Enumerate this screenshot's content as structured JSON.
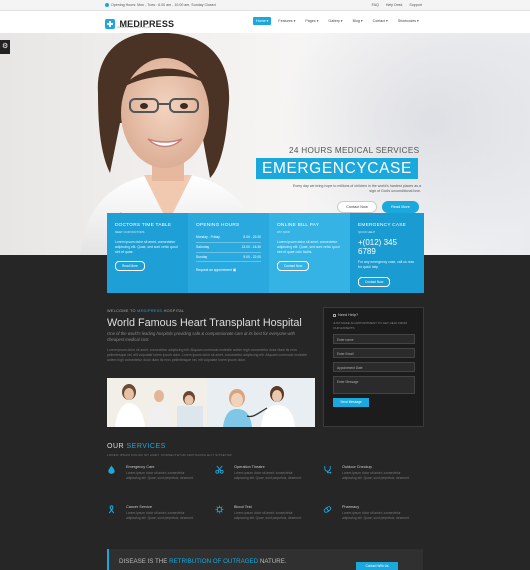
{
  "topbar": {
    "hours": "Opening Hours: Mon - Tues : 6.00 am - 10.00 am, Sunday Closed",
    "links": [
      "FAQ",
      "Help Desk",
      "Support"
    ]
  },
  "header": {
    "logo": "MEDIPRESS",
    "tagline": "medical & health care template",
    "nav": [
      {
        "label": "Home",
        "active": true
      },
      {
        "label": "Features",
        "active": false
      },
      {
        "label": "Pages",
        "active": false
      },
      {
        "label": "Gallery",
        "active": false
      },
      {
        "label": "Blog",
        "active": false
      },
      {
        "label": "Contact",
        "active": false
      },
      {
        "label": "Shortcodes",
        "active": false
      }
    ]
  },
  "hero": {
    "subtitle": "24 HOURS MEDICAL SERVICES",
    "title": "EMERGENCYCASE",
    "text": "Every day we bring hope to millions of children in the world's hardest places as a sign of God's unconditional love.",
    "btn_contact": "Contact Now",
    "btn_more": "Read More"
  },
  "boxes": {
    "timetable": {
      "title": "DOCTORS TIME TABLE",
      "sub": "MEET OUR DOCTORS",
      "text": "Lorem ipsum dolor sit amet, consectetur adipiscing elit. Quae, sed sunt vehic quod sint et quae.",
      "btn": "Read More"
    },
    "hours": {
      "title": "OPENING HOURS",
      "rows": [
        {
          "day": "Monday - Friday",
          "time": "8.00 - 22.00"
        },
        {
          "day": "Saturday",
          "time": "13.00 - 16.30"
        },
        {
          "day": "Sunday",
          "time": "9.00 - 22.00"
        }
      ],
      "link": "Request an appointment"
    },
    "bill": {
      "title": "ONLINE BILL PAY",
      "sub": "PAY NOW",
      "text": "Lorem ipsum dolor sit amet, consectetur adipiscing elit. Quae, sed sunt vehic quod sint et quae odio facilis.",
      "btn": "Contact Now"
    },
    "emergency": {
      "title": "EMERGENCY CASE",
      "sub": "QUICK HELP",
      "phone": "+(012) 345 6789",
      "text": "For any emergency case, call us now for quick help",
      "btn": "Contact Now"
    }
  },
  "welcome": {
    "kicker_pre": "WELCOME TO",
    "kicker_brand": "MEDIPRESS",
    "kicker_post": "HOSPITAL",
    "title": "World Famous Heart Transplant Hospital",
    "lead": "One of the world's leading hospitals providing safe & compassionate care at its best for everyone with cheapest medical cost.",
    "body": "Lorem ipsum dolor sit amet, consectetur adipiscing elit. Aliquam commodo molestie autem high consectetur dolor diam its eros pellentesque vel, elit vulputate lorem ipsum dolor. Lorem ipsum dolor sit amet, consectetur adipiscing elit. Aliquam commodo molestie autem high consectetur dolor diam its eros pellentesque vel, elit vulputate lorem ipsum dolor."
  },
  "form": {
    "heading": "Need Help?",
    "sub": "JUST MAKE AN APPOINTMENT TO GET HELP FROM OUR EXPERTS",
    "name": "Enter name",
    "email": "Enter Email",
    "date": "Appointment Date",
    "message": "Enter Message",
    "send": "Send Message"
  },
  "services": {
    "title_pre": "OUR",
    "title_em": "SERVICES",
    "sub": "LOREM IPSUM DOLOR SIT AMET, CONSECTETUR ADIPISCING ELIT SITSETUR",
    "items": [
      {
        "title": "Emergency Care",
        "text": "Lorem ipsum dolor sit amet, consectetur adipiscing elit. Quae, sunt perpetuis, deserunt."
      },
      {
        "title": "Operation Theatre",
        "text": "Lorem ipsum dolor sit amet, consectetur adipiscing elit. Quae, sunt perpetuis, deserunt."
      },
      {
        "title": "Outdoor Checkup",
        "text": "Lorem ipsum dolor sit amet, consectetur adipiscing elit. Quae, sunt perpetuis, deserunt."
      },
      {
        "title": "Cancer Service",
        "text": "Lorem ipsum dolor sit amet, consectetur adipiscing elit. Quae, sunt perpetuis, deserunt."
      },
      {
        "title": "Blood Test",
        "text": "Lorem ipsum dolor sit amet, consectetur adipiscing elit. Quae, sunt perpetuis, deserunt."
      },
      {
        "title": "Pharmacy",
        "text": "Lorem ipsum dolor sit amet, consectetur adipiscing elit. Quae, sunt perpetuis, deserunt."
      }
    ]
  },
  "banner": {
    "pre": "DISEASE IS THE",
    "em": "RETRIBUTION OF OUTRAGED",
    "post": "NATURE.",
    "btn": "Contact With Us"
  },
  "colors": {
    "accent": "#1aa8dd",
    "box1": "#1e9fd6",
    "box2": "#2aa9de",
    "box3": "#35b3e5",
    "box4": "#1a9bd1",
    "dark": "#262626"
  }
}
